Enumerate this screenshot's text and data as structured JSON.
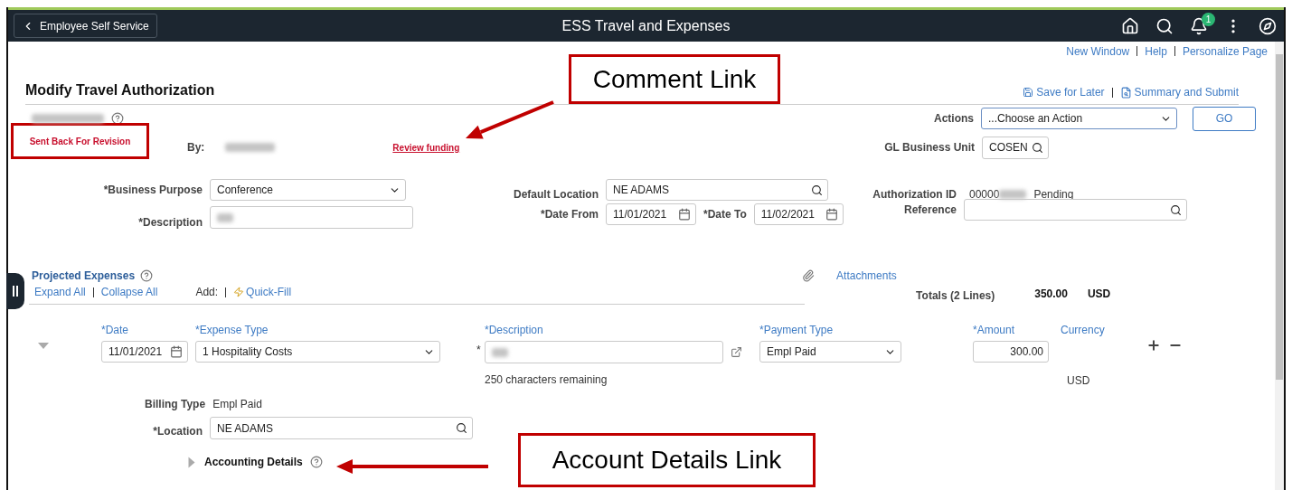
{
  "header": {
    "back_button": "Employee Self Service",
    "title": "ESS Travel and Expenses",
    "notification_count": "1"
  },
  "top_links": [
    "New Window",
    "Help",
    "Personalize Page"
  ],
  "page_title": "Modify Travel Authorization",
  "page_actions": [
    "Save for Later",
    "Summary and Submit"
  ],
  "status": "Sent Back For Revision",
  "by_label": "By:",
  "comment_link": "Review funding",
  "actions": {
    "label": "Actions",
    "value": "...Choose an Action",
    "go": "GO"
  },
  "gl_business_unit": {
    "label": "GL Business Unit",
    "value": "COSEN"
  },
  "business_purpose": {
    "label": "*Business Purpose",
    "value": "Conference"
  },
  "description": {
    "label": "*Description"
  },
  "default_location": {
    "label": "Default Location",
    "value": "NE ADAMS"
  },
  "date_from": {
    "label": "*Date From",
    "value": "11/01/2021"
  },
  "date_to": {
    "label": "*Date To",
    "value": "11/02/2021"
  },
  "authorization_id": {
    "label": "Authorization ID",
    "value": "00000",
    "status": "Pending"
  },
  "reference": {
    "label": "Reference"
  },
  "expenses": {
    "title": "Projected Expenses",
    "links": [
      "Expand All",
      "Collapse All"
    ],
    "add_label": "Add:",
    "quick_fill": "Quick-Fill",
    "attachments": "Attachments",
    "totals_label": "Totals (2 Lines)",
    "total": "350.00",
    "total_currency": "USD",
    "columns": [
      "*Date",
      "*Expense Type",
      "*Description",
      "*Payment Type",
      "*Amount",
      "Currency"
    ],
    "line": {
      "expanded": true,
      "date": "11/01/2021",
      "expense_type": "1 Hospitality Costs",
      "required_mark": "*",
      "description_hint": "250 characters remaining",
      "payment_type": "Empl Paid",
      "amount": "300.00",
      "currency": "USD",
      "billing_type_label": "Billing Type",
      "billing_type": "Empl Paid",
      "location_label": "*Location",
      "location": "NE ADAMS",
      "accounting_details": "Accounting Details",
      "accounting_details_expanded": false
    }
  },
  "callouts": [
    {
      "text": "Comment Link"
    },
    {
      "text": "Account Details Link"
    }
  ]
}
